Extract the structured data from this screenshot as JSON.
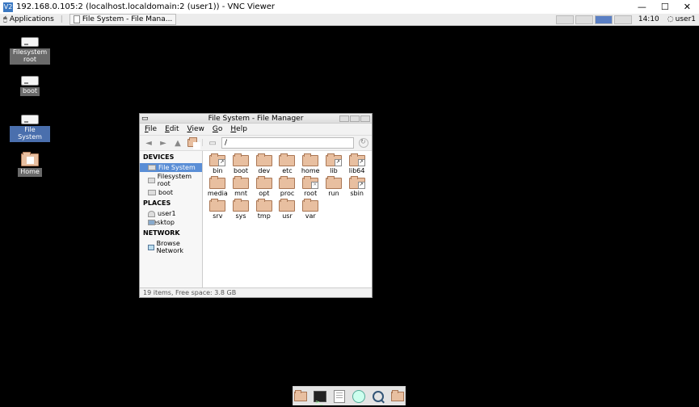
{
  "vnc": {
    "title": "192.168.0.105:2 (localhost.localdomain:2 (user1)) - VNC Viewer"
  },
  "taskbar": {
    "apps": "Applications",
    "task": "File System - File Mana...",
    "time": "14:10",
    "user": "user1"
  },
  "desktop": [
    {
      "label": "Filesystem root",
      "type": "drive"
    },
    {
      "label": "boot",
      "type": "drive"
    },
    {
      "label": "File System",
      "type": "drive",
      "sel": true
    },
    {
      "label": "Home",
      "type": "home"
    }
  ],
  "fm": {
    "title": "File System - File Manager",
    "menu": {
      "file": "File",
      "edit": "Edit",
      "view": "View",
      "go": "Go",
      "help": "Help"
    },
    "path": "/",
    "side": {
      "devices": "DEVICES",
      "fs": "File System",
      "fsroot": "Filesystem root",
      "boot": "boot",
      "places": "PLACES",
      "user": "user1",
      "desktop": "Desktop",
      "network": "NETWORK",
      "browse": "Browse Network"
    },
    "folders": [
      {
        "n": "bin",
        "c": "link"
      },
      {
        "n": "boot",
        "c": ""
      },
      {
        "n": "dev",
        "c": ""
      },
      {
        "n": "etc",
        "c": ""
      },
      {
        "n": "home",
        "c": ""
      },
      {
        "n": "lib",
        "c": "link"
      },
      {
        "n": "lib64",
        "c": "link"
      },
      {
        "n": "media",
        "c": ""
      },
      {
        "n": "mnt",
        "c": ""
      },
      {
        "n": "opt",
        "c": ""
      },
      {
        "n": "proc",
        "c": ""
      },
      {
        "n": "root",
        "c": "xx"
      },
      {
        "n": "run",
        "c": ""
      },
      {
        "n": "sbin",
        "c": "link"
      },
      {
        "n": "srv",
        "c": ""
      },
      {
        "n": "sys",
        "c": ""
      },
      {
        "n": "tmp",
        "c": ""
      },
      {
        "n": "usr",
        "c": ""
      },
      {
        "n": "var",
        "c": ""
      }
    ],
    "status": "19 items, Free space: 3.8 GB"
  }
}
